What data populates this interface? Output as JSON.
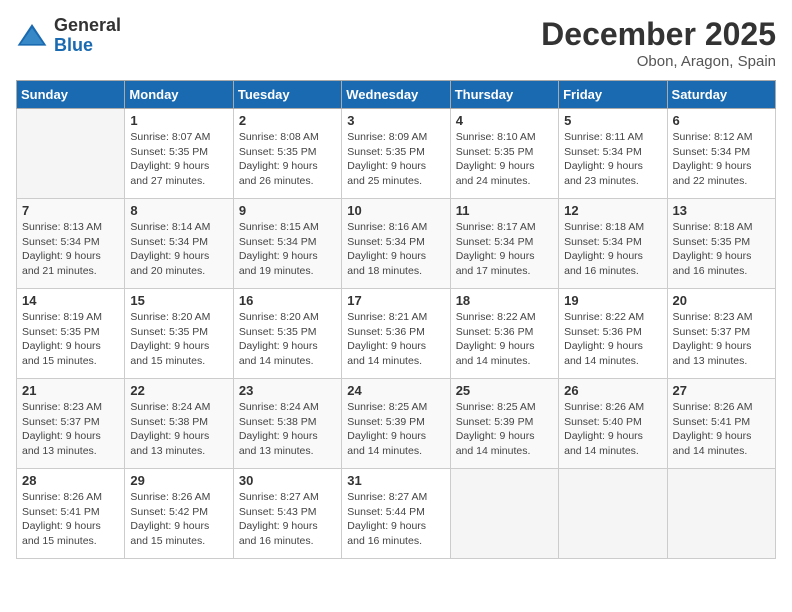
{
  "header": {
    "logo_general": "General",
    "logo_blue": "Blue",
    "month_title": "December 2025",
    "location": "Obon, Aragon, Spain"
  },
  "days_of_week": [
    "Sunday",
    "Monday",
    "Tuesday",
    "Wednesday",
    "Thursday",
    "Friday",
    "Saturday"
  ],
  "weeks": [
    [
      {
        "day": "",
        "sunrise": "",
        "sunset": "",
        "daylight": "",
        "empty": true
      },
      {
        "day": "1",
        "sunrise": "Sunrise: 8:07 AM",
        "sunset": "Sunset: 5:35 PM",
        "daylight": "Daylight: 9 hours and 27 minutes.",
        "empty": false
      },
      {
        "day": "2",
        "sunrise": "Sunrise: 8:08 AM",
        "sunset": "Sunset: 5:35 PM",
        "daylight": "Daylight: 9 hours and 26 minutes.",
        "empty": false
      },
      {
        "day": "3",
        "sunrise": "Sunrise: 8:09 AM",
        "sunset": "Sunset: 5:35 PM",
        "daylight": "Daylight: 9 hours and 25 minutes.",
        "empty": false
      },
      {
        "day": "4",
        "sunrise": "Sunrise: 8:10 AM",
        "sunset": "Sunset: 5:35 PM",
        "daylight": "Daylight: 9 hours and 24 minutes.",
        "empty": false
      },
      {
        "day": "5",
        "sunrise": "Sunrise: 8:11 AM",
        "sunset": "Sunset: 5:34 PM",
        "daylight": "Daylight: 9 hours and 23 minutes.",
        "empty": false
      },
      {
        "day": "6",
        "sunrise": "Sunrise: 8:12 AM",
        "sunset": "Sunset: 5:34 PM",
        "daylight": "Daylight: 9 hours and 22 minutes.",
        "empty": false
      }
    ],
    [
      {
        "day": "7",
        "sunrise": "Sunrise: 8:13 AM",
        "sunset": "Sunset: 5:34 PM",
        "daylight": "Daylight: 9 hours and 21 minutes.",
        "empty": false
      },
      {
        "day": "8",
        "sunrise": "Sunrise: 8:14 AM",
        "sunset": "Sunset: 5:34 PM",
        "daylight": "Daylight: 9 hours and 20 minutes.",
        "empty": false
      },
      {
        "day": "9",
        "sunrise": "Sunrise: 8:15 AM",
        "sunset": "Sunset: 5:34 PM",
        "daylight": "Daylight: 9 hours and 19 minutes.",
        "empty": false
      },
      {
        "day": "10",
        "sunrise": "Sunrise: 8:16 AM",
        "sunset": "Sunset: 5:34 PM",
        "daylight": "Daylight: 9 hours and 18 minutes.",
        "empty": false
      },
      {
        "day": "11",
        "sunrise": "Sunrise: 8:17 AM",
        "sunset": "Sunset: 5:34 PM",
        "daylight": "Daylight: 9 hours and 17 minutes.",
        "empty": false
      },
      {
        "day": "12",
        "sunrise": "Sunrise: 8:18 AM",
        "sunset": "Sunset: 5:34 PM",
        "daylight": "Daylight: 9 hours and 16 minutes.",
        "empty": false
      },
      {
        "day": "13",
        "sunrise": "Sunrise: 8:18 AM",
        "sunset": "Sunset: 5:35 PM",
        "daylight": "Daylight: 9 hours and 16 minutes.",
        "empty": false
      }
    ],
    [
      {
        "day": "14",
        "sunrise": "Sunrise: 8:19 AM",
        "sunset": "Sunset: 5:35 PM",
        "daylight": "Daylight: 9 hours and 15 minutes.",
        "empty": false
      },
      {
        "day": "15",
        "sunrise": "Sunrise: 8:20 AM",
        "sunset": "Sunset: 5:35 PM",
        "daylight": "Daylight: 9 hours and 15 minutes.",
        "empty": false
      },
      {
        "day": "16",
        "sunrise": "Sunrise: 8:20 AM",
        "sunset": "Sunset: 5:35 PM",
        "daylight": "Daylight: 9 hours and 14 minutes.",
        "empty": false
      },
      {
        "day": "17",
        "sunrise": "Sunrise: 8:21 AM",
        "sunset": "Sunset: 5:36 PM",
        "daylight": "Daylight: 9 hours and 14 minutes.",
        "empty": false
      },
      {
        "day": "18",
        "sunrise": "Sunrise: 8:22 AM",
        "sunset": "Sunset: 5:36 PM",
        "daylight": "Daylight: 9 hours and 14 minutes.",
        "empty": false
      },
      {
        "day": "19",
        "sunrise": "Sunrise: 8:22 AM",
        "sunset": "Sunset: 5:36 PM",
        "daylight": "Daylight: 9 hours and 14 minutes.",
        "empty": false
      },
      {
        "day": "20",
        "sunrise": "Sunrise: 8:23 AM",
        "sunset": "Sunset: 5:37 PM",
        "daylight": "Daylight: 9 hours and 13 minutes.",
        "empty": false
      }
    ],
    [
      {
        "day": "21",
        "sunrise": "Sunrise: 8:23 AM",
        "sunset": "Sunset: 5:37 PM",
        "daylight": "Daylight: 9 hours and 13 minutes.",
        "empty": false
      },
      {
        "day": "22",
        "sunrise": "Sunrise: 8:24 AM",
        "sunset": "Sunset: 5:38 PM",
        "daylight": "Daylight: 9 hours and 13 minutes.",
        "empty": false
      },
      {
        "day": "23",
        "sunrise": "Sunrise: 8:24 AM",
        "sunset": "Sunset: 5:38 PM",
        "daylight": "Daylight: 9 hours and 13 minutes.",
        "empty": false
      },
      {
        "day": "24",
        "sunrise": "Sunrise: 8:25 AM",
        "sunset": "Sunset: 5:39 PM",
        "daylight": "Daylight: 9 hours and 14 minutes.",
        "empty": false
      },
      {
        "day": "25",
        "sunrise": "Sunrise: 8:25 AM",
        "sunset": "Sunset: 5:39 PM",
        "daylight": "Daylight: 9 hours and 14 minutes.",
        "empty": false
      },
      {
        "day": "26",
        "sunrise": "Sunrise: 8:26 AM",
        "sunset": "Sunset: 5:40 PM",
        "daylight": "Daylight: 9 hours and 14 minutes.",
        "empty": false
      },
      {
        "day": "27",
        "sunrise": "Sunrise: 8:26 AM",
        "sunset": "Sunset: 5:41 PM",
        "daylight": "Daylight: 9 hours and 14 minutes.",
        "empty": false
      }
    ],
    [
      {
        "day": "28",
        "sunrise": "Sunrise: 8:26 AM",
        "sunset": "Sunset: 5:41 PM",
        "daylight": "Daylight: 9 hours and 15 minutes.",
        "empty": false
      },
      {
        "day": "29",
        "sunrise": "Sunrise: 8:26 AM",
        "sunset": "Sunset: 5:42 PM",
        "daylight": "Daylight: 9 hours and 15 minutes.",
        "empty": false
      },
      {
        "day": "30",
        "sunrise": "Sunrise: 8:27 AM",
        "sunset": "Sunset: 5:43 PM",
        "daylight": "Daylight: 9 hours and 16 minutes.",
        "empty": false
      },
      {
        "day": "31",
        "sunrise": "Sunrise: 8:27 AM",
        "sunset": "Sunset: 5:44 PM",
        "daylight": "Daylight: 9 hours and 16 minutes.",
        "empty": false
      },
      {
        "day": "",
        "sunrise": "",
        "sunset": "",
        "daylight": "",
        "empty": true
      },
      {
        "day": "",
        "sunrise": "",
        "sunset": "",
        "daylight": "",
        "empty": true
      },
      {
        "day": "",
        "sunrise": "",
        "sunset": "",
        "daylight": "",
        "empty": true
      }
    ]
  ]
}
